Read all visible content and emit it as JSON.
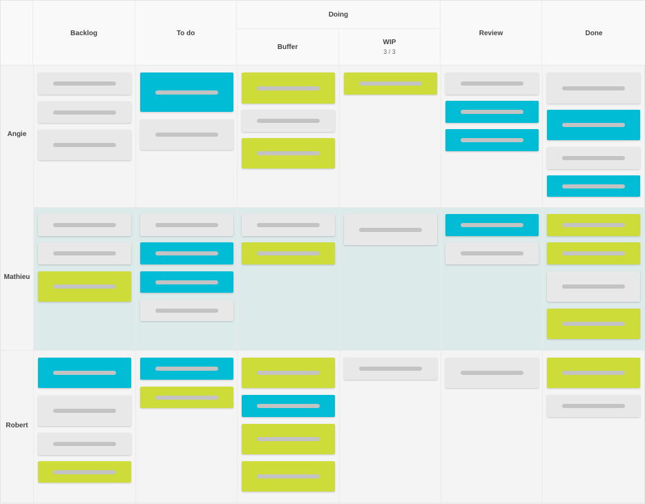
{
  "colors": {
    "grey": "#e8e8e8",
    "blue": "#00bcd4",
    "green": "#cddc39",
    "highlight_lane": "#ddeaea"
  },
  "columns": {
    "backlog": "Backlog",
    "todo": "To do",
    "doing": "Doing",
    "buffer": "Buffer",
    "wip": "WIP",
    "wip_limit": "3 / 3",
    "review": "Review",
    "done": "Done"
  },
  "lanes": [
    {
      "name": "Angie",
      "highlighted": false,
      "cards": [
        [
          "grey",
          "grey",
          "grey"
        ],
        [
          "blue",
          "grey"
        ],
        [
          "green",
          "grey",
          "green"
        ],
        [
          "green"
        ],
        [
          "grey",
          "blue",
          "blue"
        ],
        [
          "grey",
          "blue",
          "grey",
          "blue"
        ]
      ]
    },
    {
      "name": "Mathieu",
      "highlighted": true,
      "cards": [
        [
          "grey",
          "grey",
          "green"
        ],
        [
          "grey",
          "blue",
          "blue",
          "grey"
        ],
        [
          "grey",
          "green"
        ],
        [
          "grey"
        ],
        [
          "blue",
          "grey"
        ],
        [
          "green",
          "green",
          "grey",
          "green"
        ]
      ]
    },
    {
      "name": "Robert",
      "highlighted": false,
      "cards": [
        [
          "blue",
          "grey",
          "grey",
          "green"
        ],
        [
          "blue",
          "green"
        ],
        [
          "green",
          "blue",
          "green",
          "green"
        ],
        [
          "grey"
        ],
        [
          "grey"
        ],
        [
          "green",
          "grey"
        ]
      ]
    }
  ]
}
